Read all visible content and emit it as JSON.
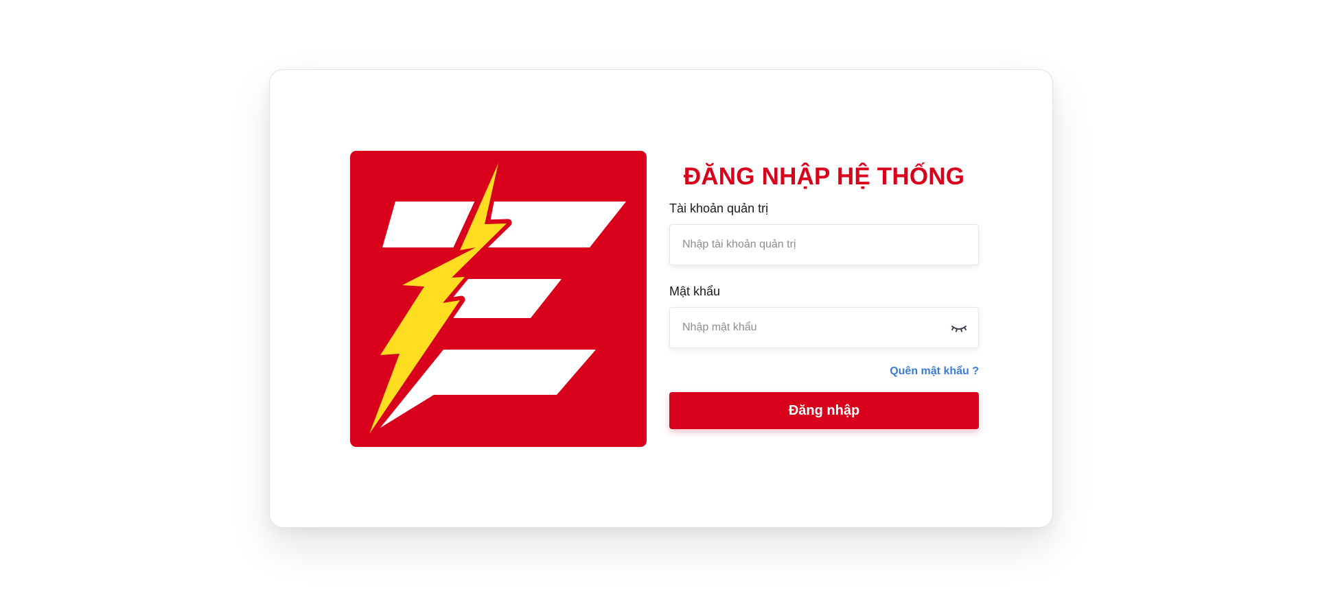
{
  "brand": {
    "background_color": "#d9001b",
    "bar_color": "#ffffff",
    "bolt_color": "#ffde21",
    "logo_icon": "lightning-e-logo"
  },
  "login": {
    "title": "ĐĂNG NHẬP HỆ THỐNG",
    "username_label": "Tài khoản quản trị",
    "username_placeholder": "Nhập tài khoản quản trị",
    "password_label": "Mật khẩu",
    "password_placeholder": "Nhập mật khẩu",
    "password_toggle_icon": "eye-closed-icon",
    "forgot_password": "Quên mật khẩu ?",
    "submit_label": "Đăng nhập",
    "link_color": "#3a7bd5"
  }
}
